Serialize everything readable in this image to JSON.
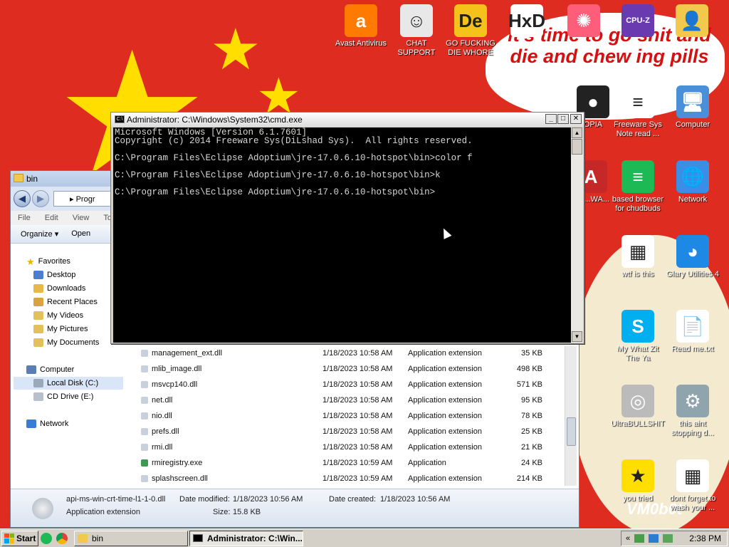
{
  "desktop": {
    "meme_text": "it's time to go shit and die and chew ing pills",
    "watermark": "VM0b0t",
    "icons": [
      {
        "name": "avast",
        "label": "Avast Antivirus",
        "color": "#ff7a00",
        "glyph": "a"
      },
      {
        "name": "chat-support",
        "label": "CHAT SUPPORT",
        "color": "#e8e8e8",
        "glyph": "☺"
      },
      {
        "name": "die",
        "label": "GO FUCKING DIE WHORE",
        "color": "#f4c21a",
        "glyph": "De"
      },
      {
        "name": "hxd",
        "label": "",
        "color": "#ffffff",
        "glyph": "HxD"
      },
      {
        "name": "pinwheel",
        "label": "",
        "color": "#ff5e7a",
        "glyph": "✺"
      },
      {
        "name": "cpuz",
        "label": "",
        "color": "#6a3bb0",
        "glyph": "CPU-Z"
      },
      {
        "name": "user-folder",
        "label": "",
        "color": "#f2c94c",
        "glyph": "👤"
      },
      {
        "name": "notepad-doc",
        "label": "Freeware Sys Note read ...",
        "color": "#ffffff",
        "glyph": "≡"
      },
      {
        "name": "computer",
        "label": "Computer",
        "color": "#4a90d9",
        "glyph": "🖥"
      },
      {
        "name": "opia",
        "label": "OPIA",
        "color": "#222222",
        "glyph": "●"
      },
      {
        "name": "browser",
        "label": "based browser for chudbuds",
        "color": "#1db954",
        "glyph": "≡"
      },
      {
        "name": "network",
        "label": "Network",
        "color": "#3a8ee6",
        "glyph": "🌐"
      },
      {
        "name": "ya",
        "label": "YA ...WA...",
        "color": "#c62828",
        "glyph": "A"
      },
      {
        "name": "wtf",
        "label": "wtf is this",
        "color": "#ffffff",
        "glyph": "▦"
      },
      {
        "name": "glary",
        "label": "Glary Utilities 4",
        "color": "#1e88e5",
        "glyph": "◕"
      },
      {
        "name": "skype",
        "label": "My What Zit The Ya",
        "color": "#00aff0",
        "glyph": "S"
      },
      {
        "name": "read-me",
        "label": "Read me.txt",
        "color": "#ffffff",
        "glyph": "📄"
      },
      {
        "name": "ultra",
        "label": "UltraBULLSHIT",
        "color": "#bbbbbb",
        "glyph": "◎"
      },
      {
        "name": "this-aint",
        "label": "this aint stopping d...",
        "color": "#90a4ae",
        "glyph": "⚙"
      },
      {
        "name": "you-tried",
        "label": "you tried",
        "color": "#ffde00",
        "glyph": "★"
      },
      {
        "name": "dont-forget",
        "label": "dont forget to wash your ...",
        "color": "#ffffff",
        "glyph": "▦"
      }
    ]
  },
  "explorer": {
    "title": "bin",
    "address": "▸ Progr",
    "menu": [
      "File",
      "Edit",
      "View",
      "Tools"
    ],
    "toolbar": {
      "organize": "Organize ▾",
      "open": "Open"
    },
    "nav": {
      "favorites": "Favorites",
      "items": [
        "Desktop",
        "Downloads",
        "Recent Places",
        "My Videos",
        "My Pictures",
        "My Documents"
      ],
      "computer": "Computer",
      "drives": [
        "Local Disk (C:)",
        "CD Drive (E:)"
      ],
      "network": "Network"
    },
    "files": [
      {
        "name": "management_ext.dll",
        "date": "1/18/2023 10:58 AM",
        "type": "Application extension",
        "size": "35 KB",
        "kind": "dll"
      },
      {
        "name": "mlib_image.dll",
        "date": "1/18/2023 10:58 AM",
        "type": "Application extension",
        "size": "498 KB",
        "kind": "dll"
      },
      {
        "name": "msvcp140.dll",
        "date": "1/18/2023 10:58 AM",
        "type": "Application extension",
        "size": "571 KB",
        "kind": "dll"
      },
      {
        "name": "net.dll",
        "date": "1/18/2023 10:58 AM",
        "type": "Application extension",
        "size": "95 KB",
        "kind": "dll"
      },
      {
        "name": "nio.dll",
        "date": "1/18/2023 10:58 AM",
        "type": "Application extension",
        "size": "78 KB",
        "kind": "dll"
      },
      {
        "name": "prefs.dll",
        "date": "1/18/2023 10:58 AM",
        "type": "Application extension",
        "size": "25 KB",
        "kind": "dll"
      },
      {
        "name": "rmi.dll",
        "date": "1/18/2023 10:58 AM",
        "type": "Application extension",
        "size": "21 KB",
        "kind": "dll"
      },
      {
        "name": "rmiregistry.exe",
        "date": "1/18/2023 10:59 AM",
        "type": "Application",
        "size": "24 KB",
        "kind": "exe"
      },
      {
        "name": "splashscreen.dll",
        "date": "1/18/2023 10:59 AM",
        "type": "Application extension",
        "size": "214 KB",
        "kind": "dll"
      }
    ],
    "details": {
      "filename": "api-ms-win-crt-time-l1-1-0.dll",
      "modified_label": "Date modified:",
      "modified": "1/18/2023 10:56 AM",
      "created_label": "Date created:",
      "created": "1/18/2023 10:56 AM",
      "type": "Application extension",
      "size_label": "Size:",
      "size": "15.8 KB"
    }
  },
  "cmd": {
    "title": "Administrator: C:\\Windows\\System32\\cmd.exe",
    "icon_text": "C:\\",
    "lines": [
      "Microsoft Windows [Version 6.1.7601]",
      "Copyright (c) 2014 Freeware Sys(DiLshad Sys).  All rights reserved.",
      "",
      "C:\\Program Files\\Eclipse Adoptium\\jre-17.0.6.10-hotspot\\bin>color f",
      "",
      "C:\\Program Files\\Eclipse Adoptium\\jre-17.0.6.10-hotspot\\bin>k",
      "",
      "C:\\Program Files\\Eclipse Adoptium\\jre-17.0.6.10-hotspot\\bin>"
    ],
    "controls": {
      "minimize": "_",
      "maximize": "□",
      "close": "✕"
    }
  },
  "taskbar": {
    "start": "Start",
    "tasks": [
      {
        "label": "bin",
        "active": false
      },
      {
        "label": "Administrator: C:\\Win...",
        "active": true
      }
    ],
    "clock": "2:38 PM",
    "tray_chevron": "«"
  }
}
